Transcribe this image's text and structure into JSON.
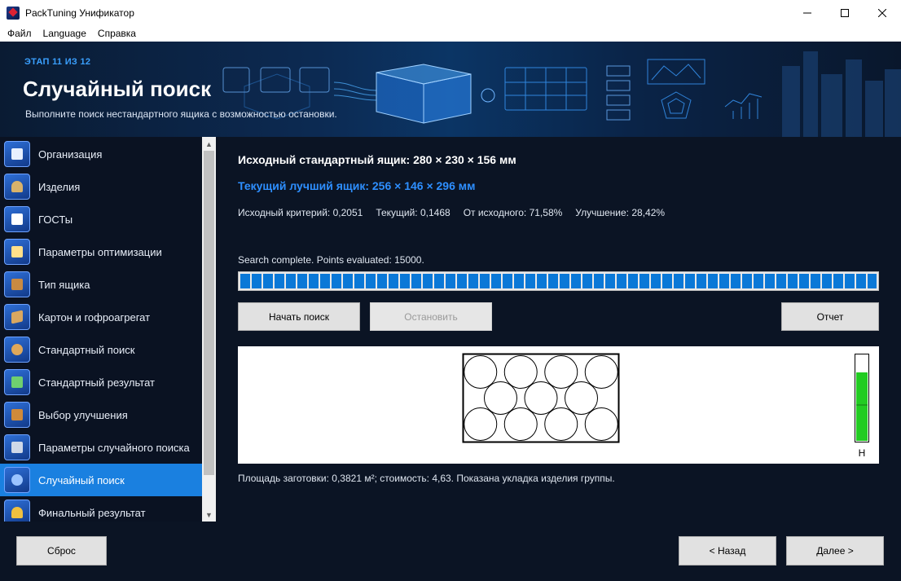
{
  "window": {
    "title": "PackTuning Унификатор"
  },
  "menu": {
    "items": [
      "Файл",
      "Language",
      "Справка"
    ]
  },
  "header": {
    "step": "ЭТАП 11 ИЗ 12",
    "title": "Случайный поиск",
    "subtitle": "Выполните поиск нестандартного ящика с возможностью остановки."
  },
  "sidebar": {
    "items": [
      {
        "label": "Организация",
        "icon": "organization-icon",
        "active": false
      },
      {
        "label": "Изделия",
        "icon": "products-icon",
        "active": false
      },
      {
        "label": "ГОСТы",
        "icon": "gost-icon",
        "active": false
      },
      {
        "label": "Параметры оптимизации",
        "icon": "optimization-params-icon",
        "active": false
      },
      {
        "label": "Тип ящика",
        "icon": "box-type-icon",
        "active": false
      },
      {
        "label": "Картон и гофроагрегат",
        "icon": "cardboard-icon",
        "active": false
      },
      {
        "label": "Стандартный поиск",
        "icon": "standard-search-icon",
        "active": false
      },
      {
        "label": "Стандартный результат",
        "icon": "standard-result-icon",
        "active": false
      },
      {
        "label": "Выбор улучшения",
        "icon": "improvement-choice-icon",
        "active": false
      },
      {
        "label": "Параметры случайного поиска",
        "icon": "random-search-params-icon",
        "active": false
      },
      {
        "label": "Случайный поиск",
        "icon": "random-search-icon",
        "active": true
      },
      {
        "label": "Финальный результат",
        "icon": "final-result-icon",
        "active": false
      }
    ]
  },
  "main": {
    "original_box": "Исходный стандартный ящик: 280 × 230 × 156 мм",
    "best_box": "Текущий лучший ящик: 256 × 146 × 296 мм",
    "criteria": {
      "original": "Исходный критерий: 0,2051",
      "current": "Текущий: 0,1468",
      "from_original": "От исходного: 71,58%",
      "improvement": "Улучшение: 28,42%"
    },
    "status": "Search complete. Points evaluated: 15000.",
    "progress_percent": 100,
    "buttons": {
      "start": "Начать поиск",
      "stop": "Остановить",
      "report": "Отчет"
    },
    "layout_rows": [
      4,
      3,
      4
    ],
    "fill_level": 0.8,
    "fill_label": "Н",
    "info": "Площадь заготовки: 0,3821 м²; стоимость: 4,63. Показана укладка изделия группы.",
    "colors": {
      "accent": "#1a80e0",
      "best_text": "#2e8fff",
      "progress": "#0a78d7",
      "fill": "#22cc22"
    }
  },
  "footer": {
    "reset": "Сброс",
    "back": "< Назад",
    "next": "Далее >"
  }
}
